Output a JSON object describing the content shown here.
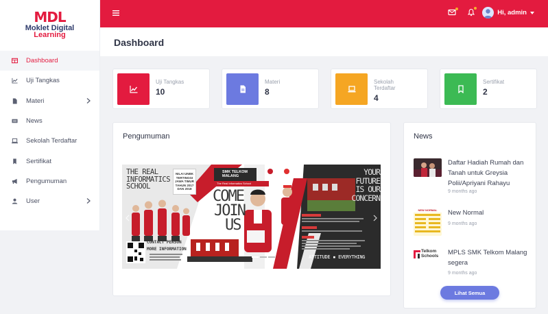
{
  "brand": {
    "logo_a": "MD",
    "logo_b": "L",
    "name_line1": "Moklet Digital",
    "name_line2": "Learning"
  },
  "sidebar": {
    "items": [
      {
        "label": "Dashboard",
        "icon": "table-icon",
        "active": true
      },
      {
        "label": "Uji Tangkas",
        "icon": "chart-icon"
      },
      {
        "label": "Materi",
        "icon": "file-icon",
        "has_submenu": true
      },
      {
        "label": "News",
        "icon": "news-icon"
      },
      {
        "label": "Sekolah Terdaftar",
        "icon": "laptop-icon"
      },
      {
        "label": "Sertifikat",
        "icon": "bookmark-icon"
      },
      {
        "label": "Pengumuman",
        "icon": "megaphone-icon"
      },
      {
        "label": "User",
        "icon": "user-icon",
        "has_submenu": true
      }
    ]
  },
  "topbar": {
    "user_greeting": "Hi, admin",
    "accent": "#e31b3f"
  },
  "page": {
    "title": "Dashboard"
  },
  "stats": [
    {
      "label": "Uji Tangkas",
      "value": "10",
      "color": "#e31b3f",
      "icon": "chart-line-icon"
    },
    {
      "label": "Materi",
      "value": "8",
      "color": "#6c7ae0",
      "icon": "document-icon"
    },
    {
      "label": "Sekolah Terdaftar",
      "value": "4",
      "color": "#f5a623",
      "icon": "laptop-icon"
    },
    {
      "label": "Sertifikat",
      "value": "2",
      "color": "#3cba54",
      "icon": "bookmark-icon"
    }
  ],
  "announcement": {
    "title": "Pengumuman",
    "banner": {
      "left_heading_1": "THE REAL",
      "left_heading_2": "INFORMATICS",
      "left_heading_3": "SCHOOL",
      "badge_1": "NILAI UNBK",
      "badge_2": "TERTINGGI",
      "badge_3": "JAWA TIMUR",
      "badge_4": "TAHUN 2017",
      "badge_5": "DAN 2018",
      "school_1": "SMK TELKOM",
      "school_2": "MALANG",
      "school_tag": "The Real Informatics School",
      "cta_1": "COME",
      "cta_2": "JOIN",
      "cta_3": "US",
      "contact": "CONTACT PERSON",
      "more_info": "MORE INFORMATION",
      "right_1": "YOUR",
      "right_2": "FUTURE",
      "right_3": "IS OUR",
      "right_4": "CONCERN",
      "attitude": "ATTITUDE",
      "everything": "EVERYTHING"
    }
  },
  "news": {
    "title": "News",
    "items": [
      {
        "title": "Daftar Hadiah Rumah dan Tanah untuk Greysia Polii/Apriyani Rahayu",
        "date": "9 months ago"
      },
      {
        "title": "New Normal",
        "date": "9 months ago",
        "thumb_text": "NEW NORMAL"
      },
      {
        "title": "MPLS SMK Telkom Malang segera",
        "date": "9 months ago",
        "thumb_text_1": "Telkom",
        "thumb_text_2": "Schools"
      }
    ],
    "more_label": "Lihat Semua"
  }
}
